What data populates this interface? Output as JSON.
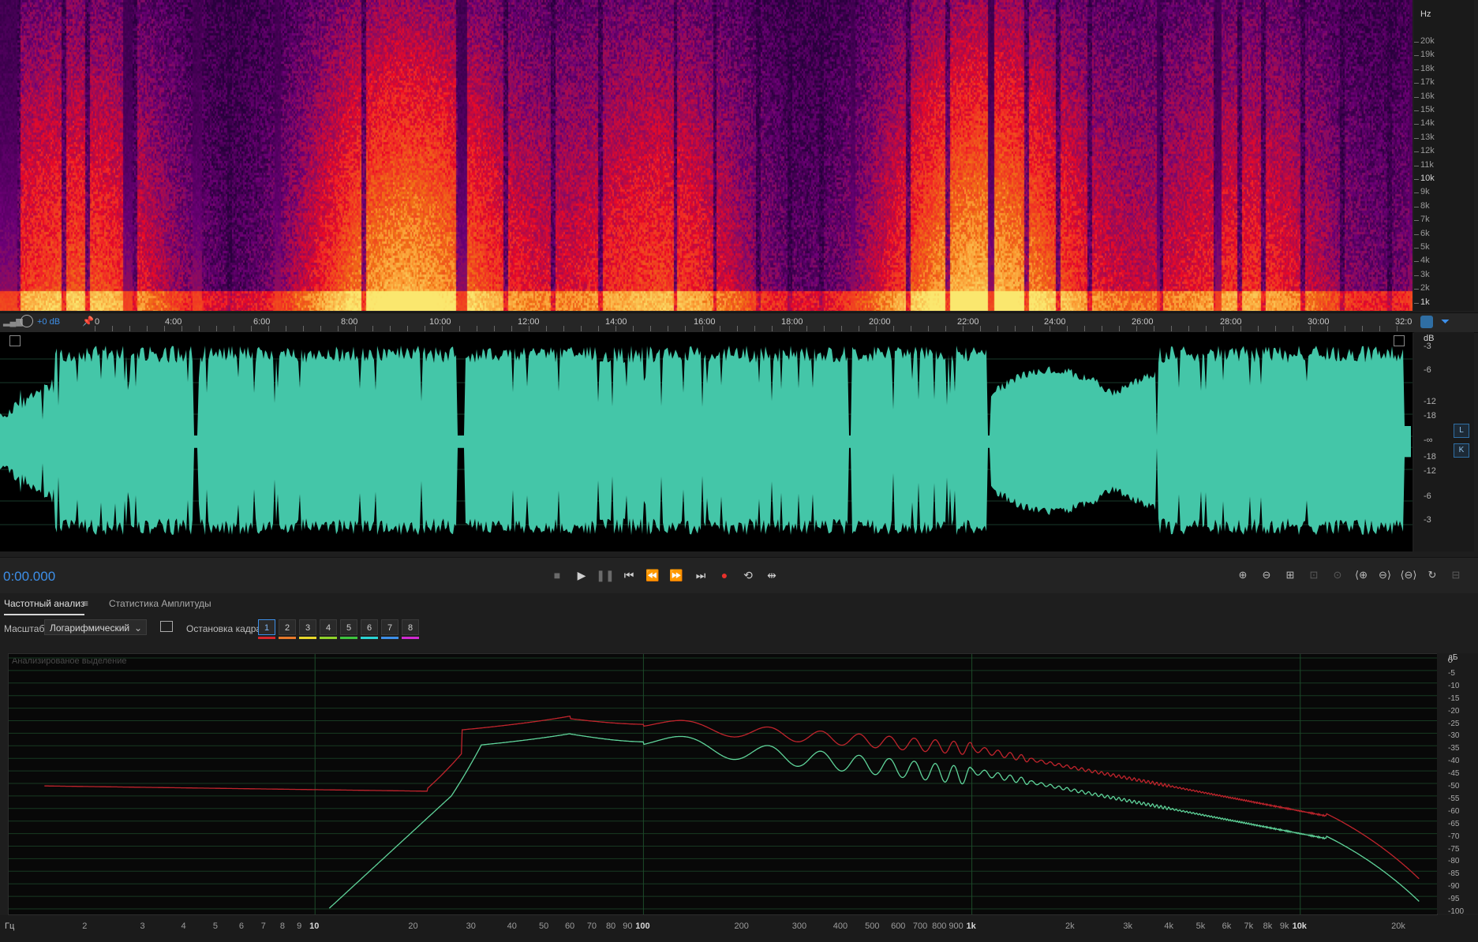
{
  "spectral": {
    "hz_unit": "Hz",
    "hz_labels": [
      "20k",
      "19k",
      "18k",
      "17k",
      "16k",
      "15k",
      "14k",
      "13k",
      "12k",
      "11k",
      "10k",
      "9k",
      "8k",
      "7k",
      "6k",
      "5k",
      "4k",
      "3k",
      "2k",
      "1k"
    ]
  },
  "ruler": {
    "gain": "+0 dB",
    "time_labels": [
      "0",
      "4:00",
      "6:00",
      "8:00",
      "10:00",
      "12:00",
      "14:00",
      "16:00",
      "18:00",
      "20:00",
      "22:00",
      "24:00",
      "26:00",
      "28:00",
      "30:00",
      "32:0"
    ]
  },
  "waveform": {
    "db_unit": "dB",
    "db_labels_top": [
      "-3",
      "-6",
      "-12",
      "-18"
    ],
    "db_center": "-∞",
    "db_labels_bottom": [
      "-18",
      "-12",
      "-6",
      "-3"
    ],
    "channel_left": "L",
    "channel_right": "K",
    "color": "#44c6a8"
  },
  "transport": {
    "time": "0:00.000",
    "buttons": [
      "stop",
      "play",
      "pause",
      "go-to-start",
      "rewind",
      "fast-forward",
      "go-to-end",
      "record",
      "loop",
      "skip-selection"
    ],
    "record_color": "#e8312b"
  },
  "panel": {
    "tab_frequency": "Частотный анализ",
    "tab_menu": "≡",
    "tab_amplitude": "Статистика Амплитуды",
    "scale_label": "Масштаб:",
    "scale_value": "Логарифмический",
    "freeze_label": "Остановка кадра:",
    "frames": [
      "1",
      "2",
      "3",
      "4",
      "5",
      "6",
      "7",
      "8"
    ],
    "frame_colors": [
      "#d6262b",
      "#e8792a",
      "#e8d82a",
      "#8fd22a",
      "#3ec43e",
      "#2ad4d4",
      "#3d8fe8",
      "#d02ad0"
    ]
  },
  "analysis": {
    "caption": "Анализированое выделение",
    "db_unit": "дБ",
    "db_labels": [
      "0",
      "-5",
      "-10",
      "-15",
      "-20",
      "-25",
      "-30",
      "-35",
      "-40",
      "-45",
      "-50",
      "-55",
      "-60",
      "-65",
      "-70",
      "-75",
      "-80",
      "-85",
      "-90",
      "-95",
      "-100"
    ],
    "x_unit": "Гц",
    "x_labels": [
      "2",
      "3",
      "4",
      "5",
      "6",
      "7",
      "8",
      "9",
      "10",
      "20",
      "30",
      "40",
      "50",
      "60",
      "70",
      "80",
      "90",
      "100",
      "200",
      "300",
      "400",
      "500",
      "600",
      "700",
      "800",
      "900",
      "1k",
      "2k",
      "3k",
      "4k",
      "5k",
      "6k",
      "7k",
      "8k",
      "9k",
      "10k",
      "20k"
    ],
    "series_colors": [
      "#c0242c",
      "#5fd49a"
    ]
  }
}
